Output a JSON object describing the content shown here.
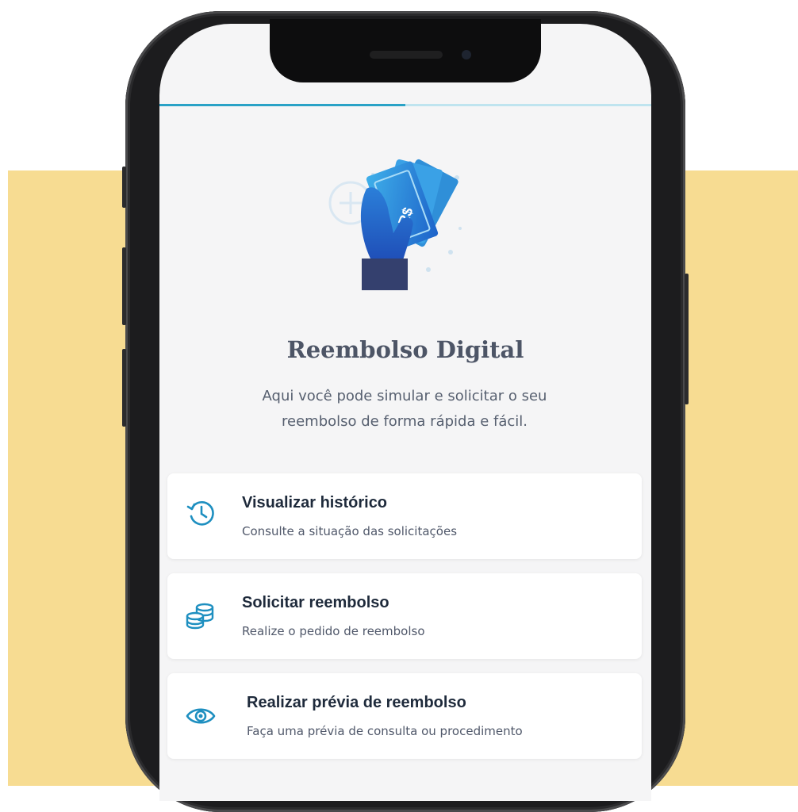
{
  "screen": {
    "progress_percent": 50,
    "title": "Reembolso Digital",
    "subtitle": "Aqui você pode simular e solicitar o seu reembolso de forma rápida e fácil.",
    "illustration": {
      "currency_label": "R$",
      "name": "hand-holding-money"
    }
  },
  "options": [
    {
      "title": "Visualizar histórico",
      "subtitle": "Consulte a situação das solicitações",
      "icon": "history-icon"
    },
    {
      "title": "Solicitar reembolso",
      "subtitle": "Realize o pedido de reembolso",
      "icon": "coins-icon"
    },
    {
      "title": "Realizar prévia de reembolso",
      "subtitle": "Faça uma prévia de consulta ou procedimento",
      "icon": "eye-icon"
    }
  ],
  "colors": {
    "accent": "#2aa2c6",
    "background_band": "#f7dc92",
    "screen_bg": "#f5f5f6",
    "title_text": "#1e2a3b"
  }
}
